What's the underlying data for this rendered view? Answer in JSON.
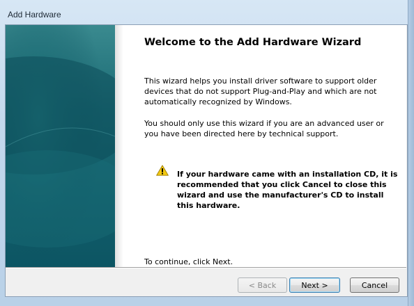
{
  "window": {
    "title": "Add Hardware"
  },
  "wizard": {
    "heading": "Welcome to the Add Hardware Wizard",
    "paragraph1": "This wizard helps you install driver software to support older devices that do not support Plug-and-Play and which are not automatically recognized by Windows.",
    "paragraph2": "You should only use this wizard if you are an advanced user or you have been directed here by technical support.",
    "warning_icon": "warning-triangle-icon",
    "warning_text": "If your hardware came with an installation CD, it is recommended that you click Cancel to close this wizard and use the manufacturer's CD to install this hardware.",
    "continue_text": "To continue, click Next."
  },
  "buttons": {
    "back": "< Back",
    "next": "Next >",
    "cancel": "Cancel"
  },
  "colors": {
    "side_panel": "#0f5563",
    "warning": "#f2c811"
  }
}
